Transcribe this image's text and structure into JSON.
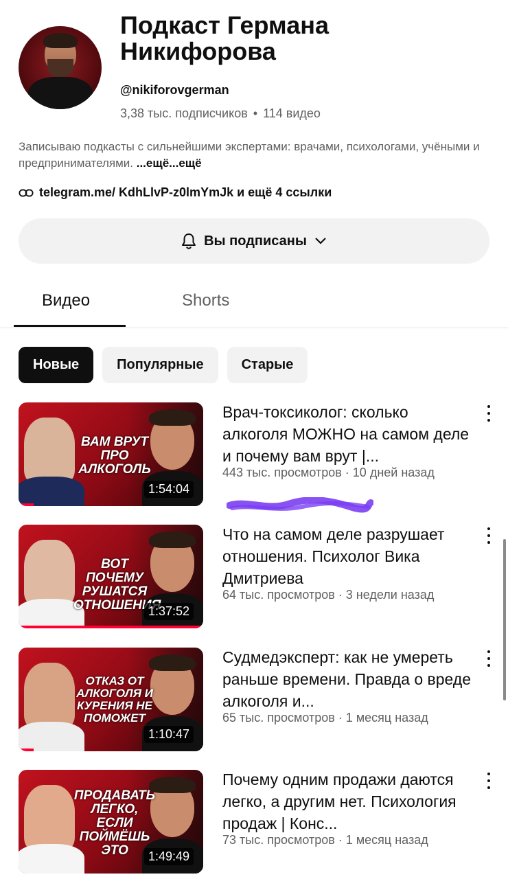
{
  "channel": {
    "title": "Подкаст Германа Никифорова",
    "handle": "@nikiforovgerman",
    "subscribers": "3,38 тыс. подписчиков",
    "separator": "•",
    "video_count": "114 видео",
    "description": "Записываю подкасты с сильнейшими экспертами: врачами, психологами, учёными и предпринимателями.",
    "more_label": "...ещё...ещё",
    "links": "telegram.me/ KdhLlvP-z0lmYmJk и ещё 4 ссылки",
    "subscribe_label": "Вы подписаны"
  },
  "tabs": [
    {
      "label": "Видео",
      "active": true
    },
    {
      "label": "Shorts",
      "active": false
    }
  ],
  "chips": [
    {
      "label": "Новые",
      "active": true
    },
    {
      "label": "Популярные",
      "active": false
    },
    {
      "label": "Старые",
      "active": false
    }
  ],
  "videos": [
    {
      "title": "Врач-токсиколог: сколько алкоголя МОЖНО на самом деле и почему вам врут  |...",
      "meta": "443 тыс. просмотров · 10 дней назад",
      "duration": "1:54:04",
      "thumb_text": "ВАМ ВРУТ ПРО АЛКОГОЛЬ",
      "watched_percent": 8
    },
    {
      "title": "Что на самом деле разрушает отношения. Психолог Вика Дмитриева",
      "meta": "64 тыс. просмотров · 3 недели назад",
      "duration": "1:37:52",
      "thumb_text": "ВОТ ПОЧЕМУ РУШАТСЯ ОТНОШЕНИЯ",
      "watched_percent": 100
    },
    {
      "title": "Судмедэксперт: как не умереть раньше времени. Правда о вреде алкоголя и...",
      "meta": "65 тыс. просмотров · 1 месяц назад",
      "duration": "1:10:47",
      "thumb_text": "ОТКАЗ ОТ АЛКОГОЛЯ И КУРЕНИЯ НЕ ПОМОЖЕТ",
      "watched_percent": 8
    },
    {
      "title": "Почему одним продажи даются легко, а другим нет. Психология продаж | Конс...",
      "meta": "73 тыс. просмотров · 1 месяц назад",
      "duration": "1:49:49",
      "thumb_text": "ПРОДАВАТЬ ЛЕГКО, ЕСЛИ ПОЙМЁШЬ ЭТО",
      "watched_percent": 0
    }
  ],
  "icons": {
    "link": "link-icon",
    "bell": "bell-icon",
    "chevron": "chevron-down-icon",
    "more": "more-vert-icon"
  },
  "colors": {
    "accent": "#ff0033",
    "chip_active_bg": "#0f0f0f",
    "chip_bg": "#f2f2f2",
    "secondary_text": "#606060",
    "scribble": "#7b3ff2"
  }
}
